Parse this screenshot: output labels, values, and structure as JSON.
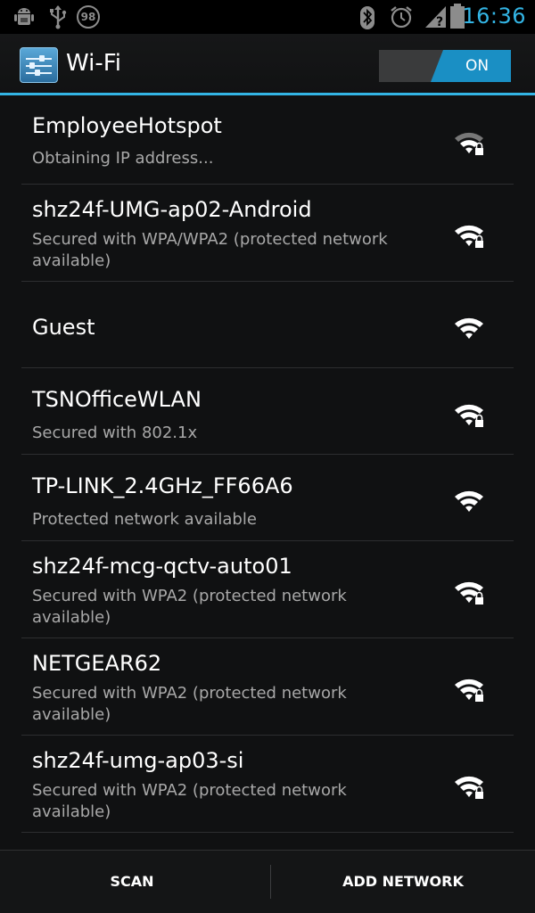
{
  "status_bar": {
    "notification_count": "98",
    "time": "16:36",
    "icons": [
      "android-debug-icon",
      "usb-icon",
      "notification-count-badge",
      "bluetooth-icon",
      "alarm-icon",
      "no-signal-icon",
      "battery-icon"
    ]
  },
  "action_bar": {
    "title": "Wi-Fi",
    "app_icon": "settings-sliders-icon",
    "toggle_label": "ON",
    "accent_color": "#33b5e5"
  },
  "networks": [
    {
      "ssid": "EmployeeHotspot",
      "summary": "Obtaining IP address...",
      "secured": true,
      "strength": "medium"
    },
    {
      "ssid": "shz24f-UMG-ap02-Android",
      "summary": "Secured with WPA/WPA2 (protected network available)",
      "secured": true,
      "strength": "full"
    },
    {
      "ssid": "Guest",
      "summary": "",
      "secured": false,
      "strength": "full"
    },
    {
      "ssid": "TSNOfficeWLAN",
      "summary": "Secured with 802.1x",
      "secured": true,
      "strength": "full"
    },
    {
      "ssid": "TP-LINK_2.4GHz_FF66A6",
      "summary": "Protected network available",
      "secured": false,
      "strength": "full"
    },
    {
      "ssid": "shz24f-mcg-qctv-auto01",
      "summary": "Secured with WPA2 (protected network available)",
      "secured": true,
      "strength": "full"
    },
    {
      "ssid": "NETGEAR62",
      "summary": "Secured with WPA2 (protected network available)",
      "secured": true,
      "strength": "full"
    },
    {
      "ssid": "shz24f-umg-ap03-si",
      "summary": "Secured with WPA2 (protected network available)",
      "secured": true,
      "strength": "full"
    }
  ],
  "bottom_bar": {
    "scan_label": "SCAN",
    "add_network_label": "ADD NETWORK"
  }
}
